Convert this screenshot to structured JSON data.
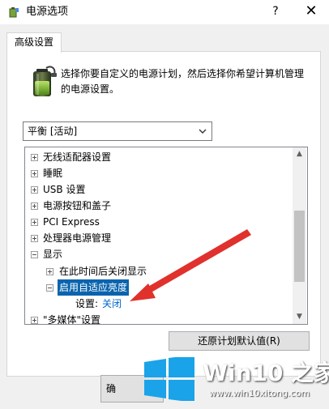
{
  "window": {
    "title": "电源选项",
    "help_glyph": "?",
    "close_glyph": "✕"
  },
  "tab": {
    "label": "高级设置"
  },
  "description": "选择你要自定义的电源计划，然后选择你希望计算机管理的电源设置。",
  "plan": {
    "selected": "平衡 [活动]"
  },
  "tree": {
    "items": [
      {
        "label": "无线适配器设置"
      },
      {
        "label": "睡眠"
      },
      {
        "label": "USB 设置"
      },
      {
        "label": "电源按钮和盖子"
      },
      {
        "label": "PCI Express"
      },
      {
        "label": "处理器电源管理"
      },
      {
        "label": "显示"
      },
      {
        "label": "在此时间后关闭显示"
      },
      {
        "label": "启用自适应亮度"
      },
      {
        "label": "\"多媒体\"设置"
      }
    ],
    "setting_label": "设置:",
    "setting_value": "关闭"
  },
  "buttons": {
    "restore": "还原计划默认值(R)",
    "ok_partial": "确"
  },
  "watermark": {
    "brand": "Win10 之家",
    "url": "www.win10xitong.com"
  },
  "colors": {
    "selection": "#0a64ad",
    "link": "#0066cc",
    "arrow": "#e0312d"
  }
}
